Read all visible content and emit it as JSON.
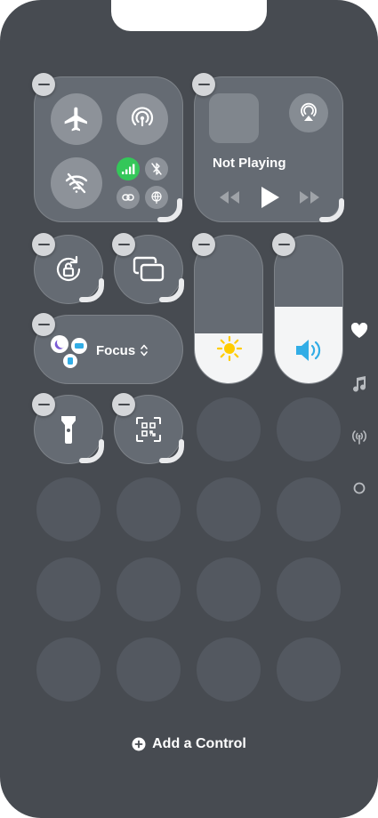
{
  "media": {
    "status_label": "Not Playing"
  },
  "focus": {
    "label": "Focus"
  },
  "footer": {
    "add_control_label": "Add a Control"
  },
  "sidebar": {
    "pages": [
      "favorites-icon",
      "music-note-icon",
      "connectivity-icon",
      "circle-page-icon"
    ],
    "selected_index": 0
  },
  "sliders": {
    "brightness_level": 0.34,
    "volume_level": 0.52
  },
  "colors": {
    "cellular_active": "#34c759",
    "volume_accent": "#32ade6",
    "brightness_accent": "#ffcc00",
    "background": "#474b51"
  }
}
